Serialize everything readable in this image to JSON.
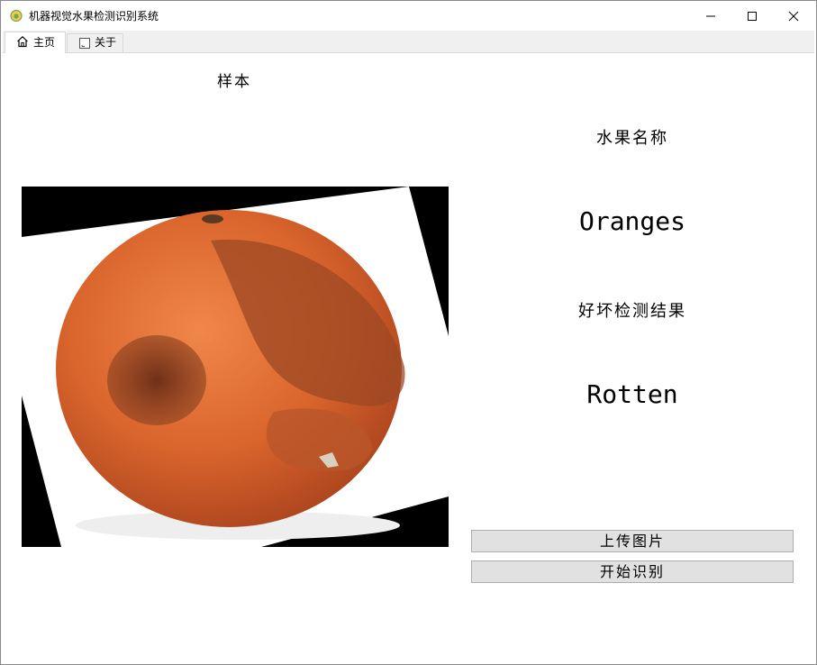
{
  "window": {
    "title": "机器视觉水果检测识别系统",
    "icon": "fruit-app-icon",
    "controls": [
      "minimize-icon",
      "maximize-icon",
      "close-icon"
    ]
  },
  "tabs": [
    {
      "label": "主页",
      "icon": "home-icon",
      "selected": true
    },
    {
      "label": "关于",
      "icon": "document-icon",
      "selected": false
    }
  ],
  "main": {
    "sample_label": "样本",
    "fruit_name_label": "水果名称",
    "fruit_name_value": "Oranges",
    "quality_label": "好坏检测结果",
    "quality_value": "Rotten",
    "upload_button": "上传图片",
    "recognize_button": "开始识别"
  },
  "colors": {
    "orange": "#d8642a",
    "rot": "#7a3a1e",
    "button_bg": "#e1e1e1",
    "button_border": "#adadad",
    "tabbar_bg": "#f0f0f0"
  }
}
